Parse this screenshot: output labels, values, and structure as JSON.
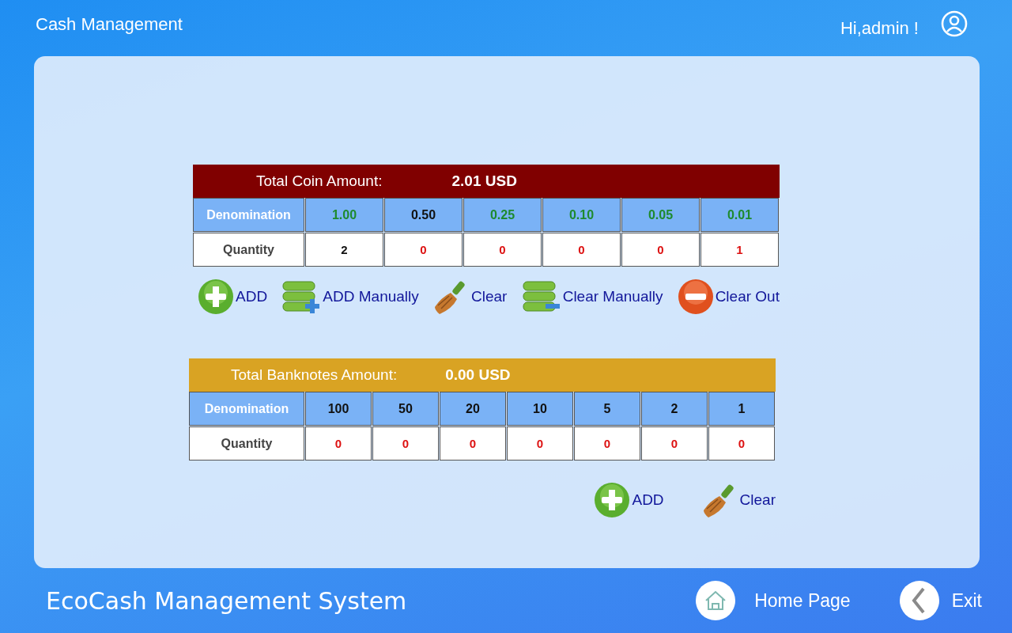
{
  "header": {
    "title": "Cash Management",
    "greeting": "Hi,admin !"
  },
  "coins": {
    "total_label": "Total Coin Amount:",
    "total_value": "2.01 USD",
    "row_labels": [
      "Denomination",
      "Quantity"
    ],
    "denominations": [
      {
        "text": "1.00",
        "color": "#1e8a2e"
      },
      {
        "text": "0.50",
        "color": "#111111"
      },
      {
        "text": "0.25",
        "color": "#1e8a2e"
      },
      {
        "text": "0.10",
        "color": "#1e8a2e"
      },
      {
        "text": "0.05",
        "color": "#1e8a2e"
      },
      {
        "text": "0.01",
        "color": "#1e8a2e"
      }
    ],
    "quantities": [
      {
        "text": "2",
        "color": "#111111"
      },
      {
        "text": "0",
        "color": "#dd1111"
      },
      {
        "text": "0",
        "color": "#dd1111"
      },
      {
        "text": "0",
        "color": "#dd1111"
      },
      {
        "text": "0",
        "color": "#dd1111"
      },
      {
        "text": "1",
        "color": "#dd1111"
      }
    ],
    "actions": [
      {
        "kind": "add",
        "label": "ADD"
      },
      {
        "kind": "add_manually",
        "label": "ADD Manually"
      },
      {
        "kind": "clear",
        "label": "Clear"
      },
      {
        "kind": "clear_manually",
        "label": "Clear Manually"
      },
      {
        "kind": "clear_out",
        "label": "Clear Out"
      }
    ]
  },
  "banknotes": {
    "total_label": "Total Banknotes Amount:",
    "total_value": "0.00 USD",
    "row_labels": [
      "Denomination",
      "Quantity"
    ],
    "denominations": [
      {
        "text": "100",
        "color": "#111111"
      },
      {
        "text": "50",
        "color": "#111111"
      },
      {
        "text": "20",
        "color": "#111111"
      },
      {
        "text": "10",
        "color": "#111111"
      },
      {
        "text": "5",
        "color": "#111111"
      },
      {
        "text": "2",
        "color": "#111111"
      },
      {
        "text": "1",
        "color": "#111111"
      }
    ],
    "quantities": [
      {
        "text": "0",
        "color": "#dd1111"
      },
      {
        "text": "0",
        "color": "#dd1111"
      },
      {
        "text": "0",
        "color": "#dd1111"
      },
      {
        "text": "0",
        "color": "#dd1111"
      },
      {
        "text": "0",
        "color": "#dd1111"
      },
      {
        "text": "0",
        "color": "#dd1111"
      },
      {
        "text": "0",
        "color": "#dd1111"
      }
    ],
    "actions": [
      {
        "kind": "add",
        "label": "ADD"
      },
      {
        "kind": "clear",
        "label": "Clear"
      }
    ]
  },
  "footer": {
    "system_name": "EcoCash Management System",
    "buttons": [
      {
        "kind": "home",
        "label": "Home Page"
      },
      {
        "kind": "back",
        "label": "Exit"
      }
    ]
  }
}
